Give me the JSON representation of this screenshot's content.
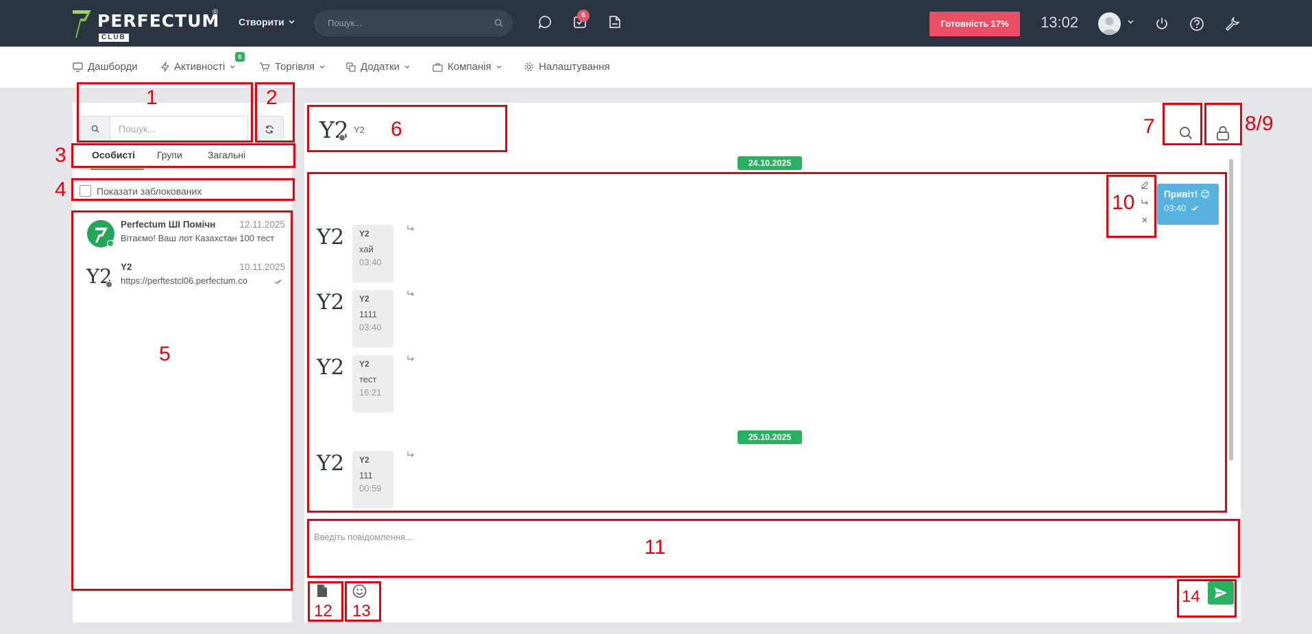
{
  "brand": {
    "name": "PERFECTUM",
    "sub": "CLUB",
    "reg": "®",
    "color": "#29b160"
  },
  "topbar": {
    "create_label": "Створити",
    "search_placeholder": "Пошук...",
    "tasks_badge": "6",
    "ready_button": "Готовність 17%",
    "time": "13:02",
    "icons": [
      "chat-icon",
      "tasks-icon",
      "notes-icon",
      "power-icon",
      "help-icon",
      "wrench-icon"
    ]
  },
  "menu": {
    "items": [
      {
        "label": "Дашборди",
        "icon": "monitor-icon"
      },
      {
        "label": "Активності",
        "icon": "bolt-icon",
        "badge": "6"
      },
      {
        "label": "Торгівля",
        "icon": "cart-icon"
      },
      {
        "label": "Додатки",
        "icon": "copy-icon"
      },
      {
        "label": "Компанія",
        "icon": "briefcase-icon"
      },
      {
        "label": "Налаштування",
        "icon": "gear-icon"
      }
    ]
  },
  "sidebar": {
    "search_placeholder": "Пошук...",
    "tabs": [
      "Особисті",
      "Групи",
      "Загальні"
    ],
    "show_blocked_label": "Показати заблокованих",
    "contacts": [
      {
        "name": "Perfectum ШІ Помічн",
        "date": "12.11.2025",
        "preview": "Вітаємо! Ваш лот Казахстан 100 тест",
        "status": "online"
      },
      {
        "name": "Y2",
        "date": "10.11.2025",
        "preview": "https://perftestcl06.perfectum.co",
        "status": "offline",
        "avatar_text": "Y2"
      }
    ]
  },
  "chat": {
    "header_avatar": "Y2",
    "header_name": "Y2",
    "dates": [
      "24.10.2025",
      "25.10.2025"
    ],
    "outgoing": {
      "text": "Привіт! 😊",
      "time": "03:40"
    },
    "messages": [
      {
        "avatar": "Y2",
        "sender": "Y2",
        "text": "хай",
        "time": "03:40"
      },
      {
        "avatar": "Y2",
        "sender": "Y2",
        "text": "1111",
        "time": "03:40"
      },
      {
        "avatar": "Y2",
        "sender": "Y2",
        "text": "тест",
        "time": "16:21"
      },
      {
        "avatar": "Y2",
        "sender": "Y2",
        "text": "111",
        "time": "00:59"
      }
    ],
    "composer_placeholder": "Введіть повідомлення..."
  },
  "annotations": [
    "1",
    "2",
    "3",
    "4",
    "5",
    "6",
    "7",
    "8/9",
    "10",
    "11",
    "12",
    "13",
    "14"
  ]
}
